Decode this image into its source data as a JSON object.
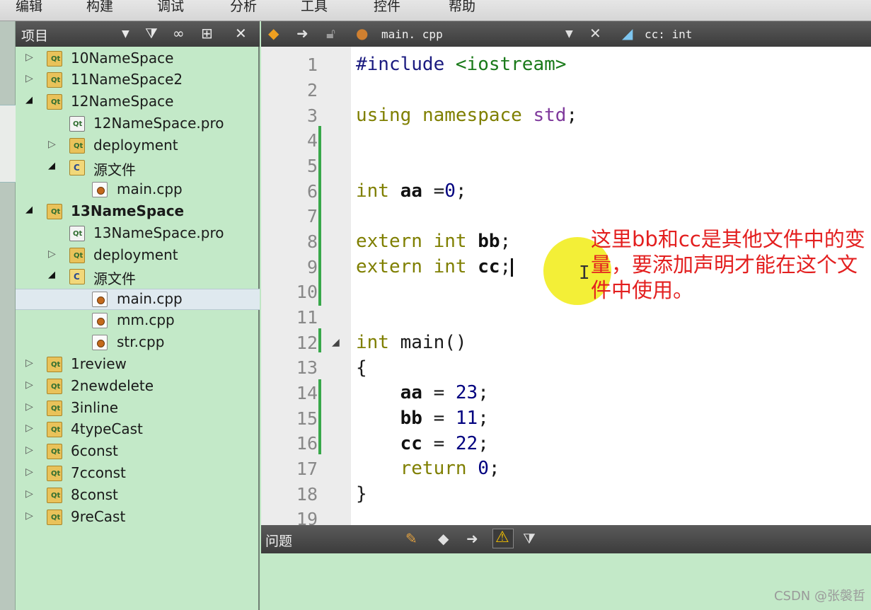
{
  "menubar": {
    "items": [
      "编辑",
      "构建",
      "调试",
      "分析",
      "工具",
      "控件",
      "帮助"
    ]
  },
  "project_panel": {
    "title": "项目"
  },
  "tree": [
    {
      "label": "10NameSpace"
    },
    {
      "label": "11NameSpace2"
    },
    {
      "label": "12NameSpace"
    },
    {
      "label": "12NameSpace.pro"
    },
    {
      "label": "deployment"
    },
    {
      "label": "源文件"
    },
    {
      "label": "main.cpp"
    },
    {
      "label": "13NameSpace"
    },
    {
      "label": "13NameSpace.pro"
    },
    {
      "label": "deployment"
    },
    {
      "label": "源文件"
    },
    {
      "label": "main.cpp"
    },
    {
      "label": "mm.cpp"
    },
    {
      "label": "str.cpp"
    },
    {
      "label": "1review"
    },
    {
      "label": "2newdelete"
    },
    {
      "label": "3inline"
    },
    {
      "label": "4typeCast"
    },
    {
      "label": "6const"
    },
    {
      "label": "7cconst"
    },
    {
      "label": "8const"
    },
    {
      "label": "9reCast"
    }
  ],
  "editor_toolbar": {
    "file_name": "main. cpp",
    "symbol": "cc: int"
  },
  "line_numbers": [
    "1",
    "2",
    "3",
    "4",
    "5",
    "6",
    "7",
    "8",
    "9",
    "10",
    "11",
    "12",
    "13",
    "14",
    "15",
    "16",
    "17",
    "18",
    "19"
  ],
  "code": {
    "l1_dir": "#include",
    "l1_hdr": "<iostream>",
    "l3_kw1": "using",
    "l3_kw2": "namespace",
    "l3_ns": "std",
    "l3_end": ";",
    "l6_kw": "int",
    "l6_id": "aa",
    "l6_op": " =",
    "l6_num": "0",
    "l6_end": ";",
    "l8_kw1": "extern",
    "l8_kw2": "int",
    "l8_id": "bb",
    "l8_end": ";",
    "l9_kw1": "extern",
    "l9_kw2": "int",
    "l9_id": "cc",
    "l9_end": ";",
    "l12_kw": "int",
    "l12_fn": "main()",
    "l13": "{",
    "l14_id": "aa",
    "l14_op": " = ",
    "l14_num": "23",
    "l14_end": ";",
    "l15_id": "bb",
    "l15_op": " = ",
    "l15_num": "11",
    "l15_end": ";",
    "l16_id": "cc",
    "l16_op": " = ",
    "l16_num": "22",
    "l16_end": ";",
    "l17_kw": "return",
    "l17_num": "0",
    "l17_end": ";",
    "l18": "}"
  },
  "annotation": "这里bb和cc是其他文件中的变量，要添加声明才能在这个文件中使用。",
  "issues_panel": {
    "title": "问题"
  },
  "watermark": "CSDN @张褩哲"
}
